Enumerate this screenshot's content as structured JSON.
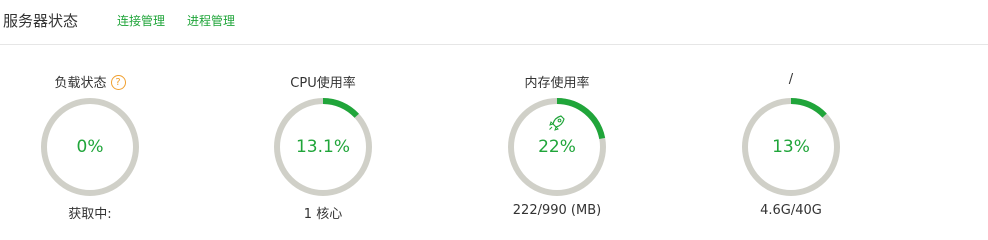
{
  "header": {
    "title": "服务器状态",
    "links": [
      "连接管理",
      "进程管理"
    ]
  },
  "gauges": [
    {
      "label": "负载状态",
      "value_text": "0%",
      "value": 0,
      "sub": "获取中:",
      "has_help": true
    },
    {
      "label": "CPU使用率",
      "value_text": "13.1%",
      "value": 13.1,
      "sub": "1 核心"
    },
    {
      "label": "内存使用率",
      "value_text": "22%",
      "value": 22,
      "sub": "222/990 (MB)",
      "icon": "rocket-icon"
    },
    {
      "label": "/",
      "value_text": "13%",
      "value": 13,
      "sub": "4.6G/40G"
    }
  ],
  "colors": {
    "accent": "#20a53a",
    "track": "#d0d0c8",
    "help": "#f0a030"
  }
}
